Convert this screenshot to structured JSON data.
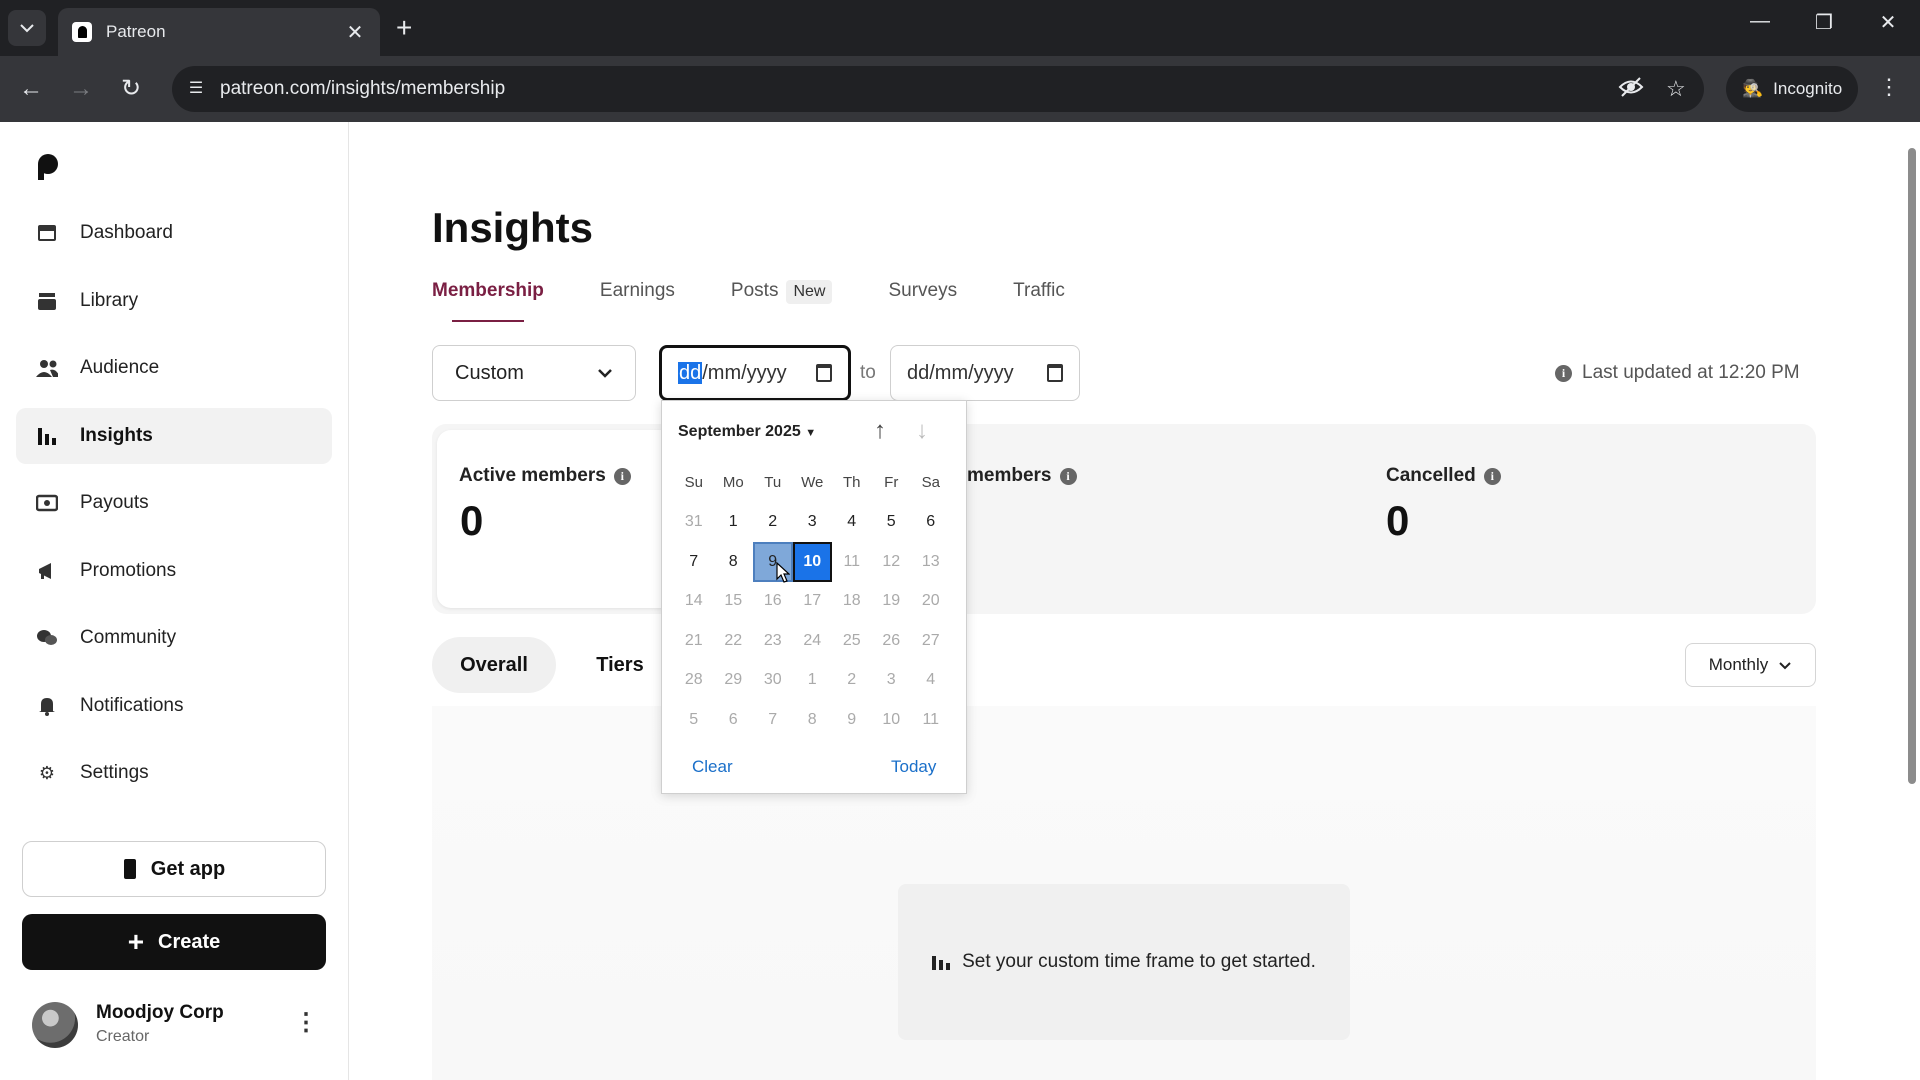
{
  "browser": {
    "tab_title": "Patreon",
    "url": "patreon.com/insights/membership",
    "incognito_label": "Incognito"
  },
  "sidebar": {
    "items": [
      {
        "label": "Dashboard",
        "icon": "dashboard-icon"
      },
      {
        "label": "Library",
        "icon": "library-icon"
      },
      {
        "label": "Audience",
        "icon": "audience-icon"
      },
      {
        "label": "Insights",
        "icon": "insights-icon",
        "active": true
      },
      {
        "label": "Payouts",
        "icon": "payouts-icon"
      },
      {
        "label": "Promotions",
        "icon": "promotions-icon"
      },
      {
        "label": "Community",
        "icon": "community-icon"
      },
      {
        "label": "Notifications",
        "icon": "bell-icon"
      },
      {
        "label": "Settings",
        "icon": "gear-icon"
      }
    ],
    "get_app_label": "Get app",
    "create_label": "Create",
    "profile": {
      "name": "Moodjoy Corp",
      "role": "Creator"
    }
  },
  "main": {
    "title": "Insights",
    "tabs": [
      {
        "label": "Membership",
        "active": true
      },
      {
        "label": "Earnings"
      },
      {
        "label": "Posts",
        "badge": "New"
      },
      {
        "label": "Surveys"
      },
      {
        "label": "Traffic"
      }
    ],
    "range_select": "Custom",
    "date_from": {
      "dd": "dd",
      "rest": "/mm/yyyy"
    },
    "to_label": "to",
    "date_to": "dd/mm/yyyy",
    "last_updated": "Last updated at 12:20 PM",
    "stats": [
      {
        "label": "Active members",
        "value": "0"
      },
      {
        "label": "members"
      },
      {
        "label": "Cancelled",
        "value": "0"
      }
    ],
    "segments": [
      "Overall",
      "Tiers"
    ],
    "period_select": "Monthly",
    "empty_message": "Set your custom time frame to get started."
  },
  "calendar": {
    "month_label": "September 2025",
    "weekdays": [
      "Su",
      "Mo",
      "Tu",
      "We",
      "Th",
      "Fr",
      "Sa"
    ],
    "weeks": [
      [
        "31",
        "1",
        "2",
        "3",
        "4",
        "5",
        "6"
      ],
      [
        "7",
        "8",
        "9",
        "10",
        "11",
        "12",
        "13"
      ],
      [
        "14",
        "15",
        "16",
        "17",
        "18",
        "19",
        "20"
      ],
      [
        "21",
        "22",
        "23",
        "24",
        "25",
        "26",
        "27"
      ],
      [
        "28",
        "29",
        "30",
        "1",
        "2",
        "3",
        "4"
      ],
      [
        "5",
        "6",
        "7",
        "8",
        "9",
        "10",
        "11"
      ]
    ],
    "today": "10",
    "hovered": "9",
    "clear_label": "Clear",
    "today_label": "Today"
  },
  "colors": {
    "accent": "#7a1f43",
    "link": "#1a6fc9",
    "selected": "#1a73e8"
  }
}
